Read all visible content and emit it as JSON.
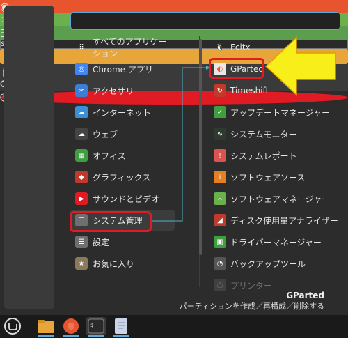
{
  "search": {
    "value": ""
  },
  "favorites": [
    {
      "name": "firefox-icon",
      "color": "#e8542e",
      "glyph": "◉"
    },
    {
      "name": "software-manager-icon",
      "color": "#6ab04c",
      "glyph": "⁙"
    },
    {
      "name": "settings-toggle-icon",
      "color": "#5b9e4e",
      "glyph": "☰"
    },
    {
      "name": "terminal-icon",
      "color": "#2a2a2a",
      "glyph": "$_"
    },
    {
      "name": "folder-icon",
      "color": "#e8a63a",
      "glyph": ""
    },
    {
      "name": "lock-icon",
      "color": "#3a3a3a",
      "glyph": "🔒"
    },
    {
      "name": "logout-icon",
      "color": "#3a3a3a",
      "glyph": "⟳"
    },
    {
      "name": "power-icon",
      "color": "#e01b24",
      "glyph": "⏻"
    }
  ],
  "categories": [
    {
      "label": "すべてのアプリケーション",
      "icon": "grid-icon",
      "color": "transparent",
      "glyph": "⠿"
    },
    {
      "label": "Chrome アプリ",
      "icon": "chrome-icon",
      "color": "#4285f4",
      "glyph": "◎"
    },
    {
      "label": "アクセサリ",
      "icon": "scissors-icon",
      "color": "#3b7dd8",
      "glyph": "✂"
    },
    {
      "label": "インターネット",
      "icon": "cloud-icon",
      "color": "#3b8fd8",
      "glyph": "☁"
    },
    {
      "label": "ウェブ",
      "icon": "cloud-web-icon",
      "color": "#444",
      "glyph": "☁"
    },
    {
      "label": "オフィス",
      "icon": "office-icon",
      "color": "#3f9e3f",
      "glyph": "▦"
    },
    {
      "label": "グラフィックス",
      "icon": "graphics-icon",
      "color": "#c0392b",
      "glyph": "◆"
    },
    {
      "label": "サウンドとビデオ",
      "icon": "play-icon",
      "color": "#e01b24",
      "glyph": "▶"
    },
    {
      "label": "システム管理",
      "icon": "system-admin-icon",
      "color": "#6f6f6f",
      "glyph": "☰"
    },
    {
      "label": "設定",
      "icon": "settings-icon",
      "color": "#6f6f6f",
      "glyph": "☰"
    },
    {
      "label": "お気に入り",
      "icon": "favorites-folder-icon",
      "color": "#8a7a5a",
      "glyph": "★"
    }
  ],
  "apps": [
    {
      "label": "Fcitx",
      "icon": "penguin-icon",
      "color": "transparent",
      "glyph": "🐧"
    },
    {
      "label": "GParted",
      "icon": "gparted-icon",
      "color": "#e8e8e8",
      "glyph": "◐"
    },
    {
      "label": "Timeshift",
      "icon": "timeshift-icon",
      "color": "#c0392b",
      "glyph": "↻"
    },
    {
      "label": "アップデートマネージャー",
      "icon": "shield-icon",
      "color": "#3f9e3f",
      "glyph": "✓"
    },
    {
      "label": "システムモニター",
      "icon": "monitor-icon",
      "color": "#2f3a2f",
      "glyph": "∿"
    },
    {
      "label": "システムレポート",
      "icon": "report-icon",
      "color": "#d9534f",
      "glyph": "!"
    },
    {
      "label": "ソフトウェアソース",
      "icon": "info-icon",
      "color": "#e67e22",
      "glyph": "i"
    },
    {
      "label": "ソフトウェアマネージャー",
      "icon": "software-manager-icon",
      "color": "#6ab04c",
      "glyph": "⁙"
    },
    {
      "label": "ディスク使用量アナライザー",
      "icon": "disk-usage-icon",
      "color": "#c0392b",
      "glyph": "◢"
    },
    {
      "label": "ドライバーマネージャー",
      "icon": "driver-icon",
      "color": "#3f9e3f",
      "glyph": "▣"
    },
    {
      "label": "バックアップツール",
      "icon": "backup-icon",
      "color": "#555",
      "glyph": "◔"
    },
    {
      "label": "プリンター",
      "icon": "printer-icon",
      "color": "#666",
      "glyph": "⎙"
    }
  ],
  "description": {
    "title": "GParted",
    "text": "パーティションを作成／再構成／削除する"
  },
  "panel": [
    {
      "name": "mint-menu-icon"
    },
    {
      "name": "files-icon"
    },
    {
      "name": "firefox-icon"
    },
    {
      "name": "terminal-icon"
    },
    {
      "name": "text-editor-icon"
    }
  ]
}
